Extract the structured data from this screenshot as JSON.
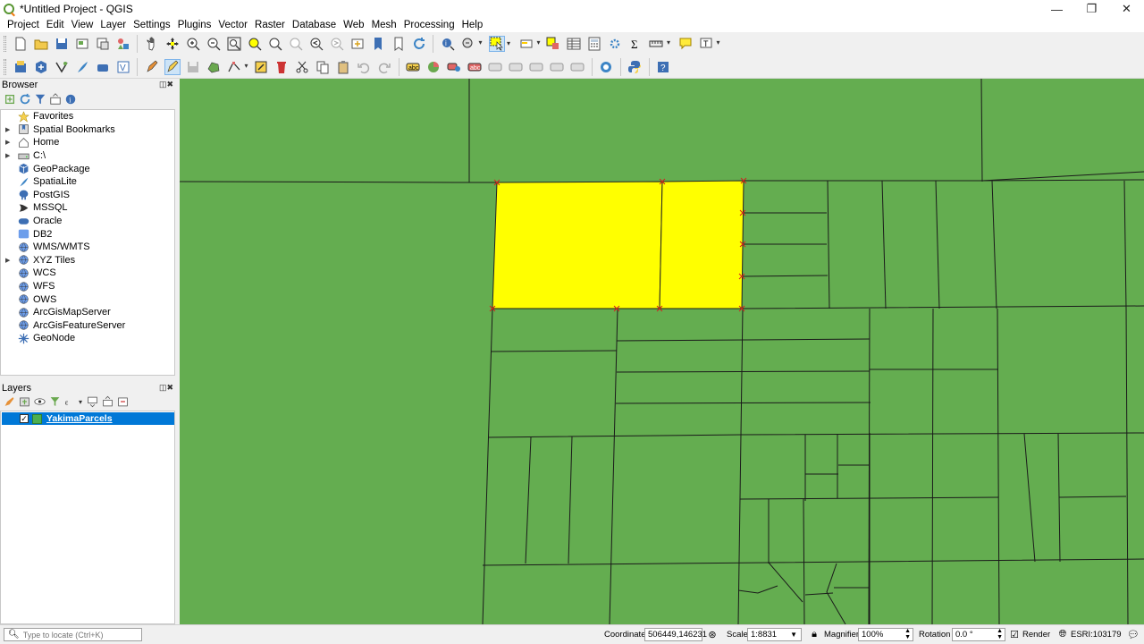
{
  "window": {
    "title": "*Untitled Project - QGIS",
    "controls": [
      "—",
      "❐",
      "✕"
    ]
  },
  "menu": [
    "Project",
    "Edit",
    "View",
    "Layer",
    "Settings",
    "Plugins",
    "Vector",
    "Raster",
    "Database",
    "Web",
    "Mesh",
    "Processing",
    "Help"
  ],
  "browser": {
    "title": "Browser",
    "items": [
      {
        "label": "Favorites",
        "icon": "star-icon",
        "expandable": false
      },
      {
        "label": "Spatial Bookmarks",
        "icon": "bookmark-icon",
        "expandable": true
      },
      {
        "label": "Home",
        "icon": "home-icon",
        "expandable": true
      },
      {
        "label": "C:\\",
        "icon": "drive-icon",
        "expandable": true
      },
      {
        "label": "GeoPackage",
        "icon": "geopackage-icon",
        "expandable": false
      },
      {
        "label": "SpatiaLite",
        "icon": "feather-icon",
        "expandable": false
      },
      {
        "label": "PostGIS",
        "icon": "elephant-icon",
        "expandable": false
      },
      {
        "label": "MSSQL",
        "icon": "mssql-icon",
        "expandable": false
      },
      {
        "label": "Oracle",
        "icon": "oracle-icon",
        "expandable": false
      },
      {
        "label": "DB2",
        "icon": "db2-icon",
        "expandable": false
      },
      {
        "label": "WMS/WMTS",
        "icon": "globe-icon",
        "expandable": false
      },
      {
        "label": "XYZ Tiles",
        "icon": "globe-icon",
        "expandable": true
      },
      {
        "label": "WCS",
        "icon": "globe-icon",
        "expandable": false
      },
      {
        "label": "WFS",
        "icon": "globe-icon",
        "expandable": false
      },
      {
        "label": "OWS",
        "icon": "globe-icon",
        "expandable": false
      },
      {
        "label": "ArcGisMapServer",
        "icon": "globe-icon",
        "expandable": false
      },
      {
        "label": "ArcGisFeatureServer",
        "icon": "globe-icon",
        "expandable": false
      },
      {
        "label": "GeoNode",
        "icon": "geonode-icon",
        "expandable": false
      }
    ]
  },
  "layers": {
    "title": "Layers",
    "items": [
      {
        "name": "YakimaParcels",
        "checked": true,
        "selected": true
      }
    ]
  },
  "status": {
    "locator_placeholder": "Type to locate (Ctrl+K)",
    "coordinate_label": "Coordinate",
    "coordinate_value": "506449,146231",
    "scale_label": "Scale",
    "scale_value": "1:8831",
    "magnifier_label": "Magnifier",
    "magnifier_value": "100%",
    "rotation_label": "Rotation",
    "rotation_value": "0.0 °",
    "render_label": "Render",
    "render_checked": true,
    "crs_label": "ESRI:103179"
  },
  "colors": {
    "map_fill": "#64ad50",
    "selection_fill": "#ffff00",
    "selection_vertex": "#d62020",
    "layer_selected_bg": "#0078d7"
  }
}
